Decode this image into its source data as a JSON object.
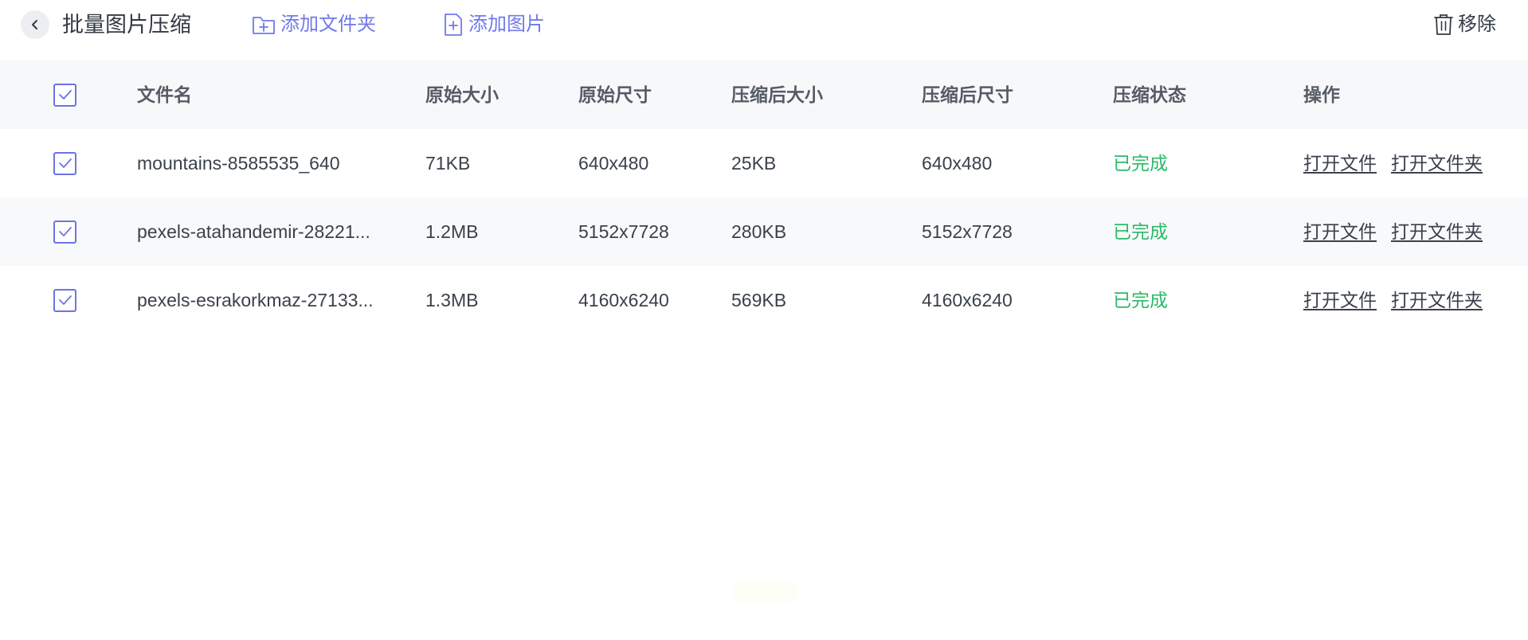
{
  "header": {
    "title": "批量图片压缩",
    "add_folder_label": "添加文件夹",
    "add_image_label": "添加图片",
    "remove_label": "移除"
  },
  "table": {
    "columns": {
      "name": "文件名",
      "original_size": "原始大小",
      "original_dimensions": "原始尺寸",
      "compressed_size": "压缩后大小",
      "compressed_dimensions": "压缩后尺寸",
      "status": "压缩状态",
      "actions": "操作"
    },
    "rows": [
      {
        "name": "mountains-8585535_640",
        "original_size": "71KB",
        "original_dimensions": "640x480",
        "compressed_size": "25KB",
        "compressed_dimensions": "640x480",
        "status": "已完成",
        "open_file": "打开文件",
        "open_folder": "打开文件夹"
      },
      {
        "name": "pexels-atahandemir-28221...",
        "original_size": "1.2MB",
        "original_dimensions": "5152x7728",
        "compressed_size": "280KB",
        "compressed_dimensions": "5152x7728",
        "status": "已完成",
        "open_file": "打开文件",
        "open_folder": "打开文件夹"
      },
      {
        "name": "pexels-esrakorkmaz-27133...",
        "original_size": "1.3MB",
        "original_dimensions": "4160x6240",
        "compressed_size": "569KB",
        "compressed_dimensions": "4160x6240",
        "status": "已完成",
        "open_file": "打开文件",
        "open_folder": "打开文件夹"
      }
    ]
  },
  "colors": {
    "accent": "#6a74e6",
    "link_accent": "#7079ea",
    "status_done": "#2cba6a",
    "header_row_bg": "#f7f8f9"
  },
  "icons": {
    "back": "chevron-left-icon",
    "add_folder": "folder-plus-icon",
    "add_image": "file-plus-icon",
    "remove": "trash-icon",
    "checkbox": "check-icon"
  }
}
